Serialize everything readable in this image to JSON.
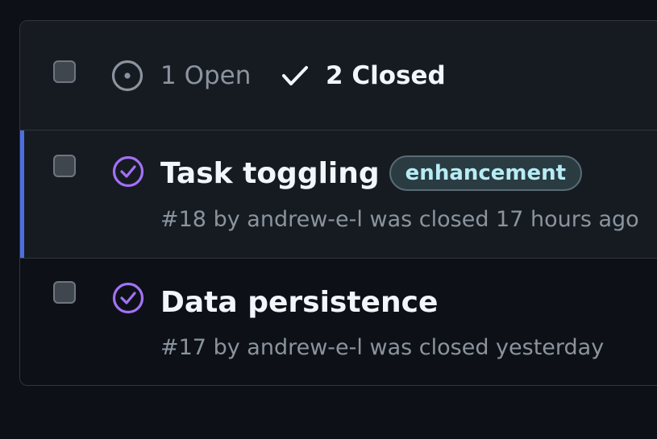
{
  "header": {
    "open_label": "1 Open",
    "closed_label": "2 Closed"
  },
  "issues": [
    {
      "title": "Task toggling",
      "label": "enhancement",
      "number": "#18",
      "by": "by",
      "author": "andrew-e-l",
      "status_text": "was closed 17 hours ago"
    },
    {
      "title": "Data persistence",
      "number": "#17",
      "by": "by",
      "author": "andrew-e-l",
      "status_text": "was closed yesterday"
    }
  ],
  "colors": {
    "closed_icon": "#a371f7",
    "accent_bar": "#4c6fdf",
    "label_text": "#b7ecf5"
  }
}
